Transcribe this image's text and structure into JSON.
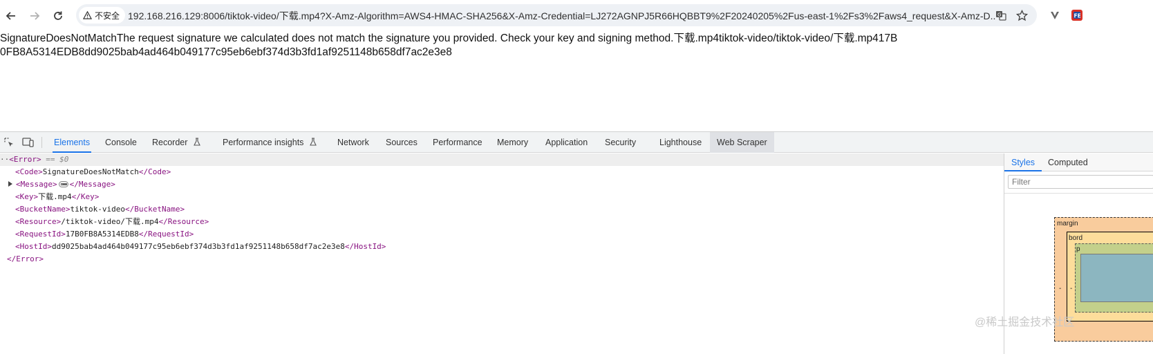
{
  "browser": {
    "security_label": "不安全",
    "url": "192.168.216.129:8006/tiktok-video/下载.mp4?X-Amz-Algorithm=AWS4-HMAC-SHA256&X-Amz-Credential=LJ272AGNPJ5R66HQBBT9%2F20240205%2Fus-east-1%2Fs3%2Faws4_request&X-Amz-D..."
  },
  "page": {
    "error_text": "SignatureDoesNotMatchThe request signature we calculated does not match the signature you provided. Check your key and signing method.下载.mp4tiktok-video/tiktok-video/下载.mp417B0FB8A5314EDB8dd9025bab4ad464b049177c95eb6ebf374d3b3fd1af9251148b658df7ac2e3e8"
  },
  "devtools": {
    "tabs": [
      "Elements",
      "Console",
      "Recorder",
      "Performance insights",
      "Network",
      "Sources",
      "Performance",
      "Memory",
      "Application",
      "Security",
      "Lighthouse",
      "Web Scraper"
    ],
    "active_tab": "Elements",
    "dom": {
      "root_open": "<Error>",
      "root_suffix": "== $0",
      "code_open": "<Code>",
      "code_value": "SignatureDoesNotMatch",
      "code_close": "</Code>",
      "message_open": "<Message>",
      "message_close": "</Message>",
      "key_open": "<Key>",
      "key_value": "下载.mp4",
      "key_close": "</Key>",
      "bucket_open": "<BucketName>",
      "bucket_value": "tiktok-video",
      "bucket_close": "</BucketName>",
      "resource_open": "<Resource>",
      "resource_value": "/tiktok-video/下载.mp4",
      "resource_close": "</Resource>",
      "requestid_open": "<RequestId>",
      "requestid_value": "17B0FB8A5314EDB8",
      "requestid_close": "</RequestId>",
      "hostid_open": "<HostId>",
      "hostid_value": "dd9025bab4ad464b049177c95eb6ebf374d3b3fd1af9251148b658df7ac2e3e8",
      "hostid_close": "</HostId>",
      "root_close": "</Error>"
    },
    "styles_tabs": [
      "Styles",
      "Computed"
    ],
    "filter_placeholder": "Filter",
    "box_model": {
      "margin_label": "margin",
      "border_label": "bord",
      "padding_label": "p",
      "dash": "-"
    }
  },
  "watermark": "@稀土掘金技术社区",
  "colors": {
    "accent": "#1a73e8",
    "tag": "#881280"
  }
}
